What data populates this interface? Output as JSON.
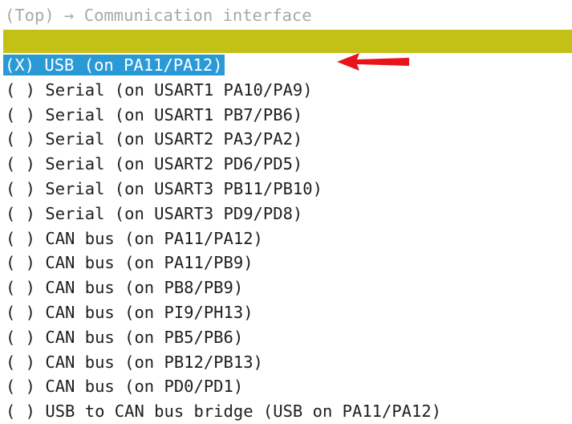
{
  "header": {
    "text": "(Top) → Communication interface"
  },
  "options": [
    {
      "label": "(X) USB (on PA11/PA12)",
      "selected": true
    },
    {
      "label": "( ) Serial (on USART1 PA10/PA9)",
      "selected": false
    },
    {
      "label": "( ) Serial (on USART1 PB7/PB6)",
      "selected": false
    },
    {
      "label": "( ) Serial (on USART2 PA3/PA2)",
      "selected": false
    },
    {
      "label": "( ) Serial (on USART2 PD6/PD5)",
      "selected": false
    },
    {
      "label": "( ) Serial (on USART3 PB11/PB10)",
      "selected": false
    },
    {
      "label": "( ) Serial (on USART3 PD9/PD8)",
      "selected": false
    },
    {
      "label": "( ) CAN bus (on PA11/PA12)",
      "selected": false
    },
    {
      "label": "( ) CAN bus (on PA11/PB9)",
      "selected": false
    },
    {
      "label": "( ) CAN bus (on PB8/PB9)",
      "selected": false
    },
    {
      "label": "( ) CAN bus (on PI9/PH13)",
      "selected": false
    },
    {
      "label": "( ) CAN bus (on PB5/PB6)",
      "selected": false
    },
    {
      "label": "( ) CAN bus (on PB12/PB13)",
      "selected": false
    },
    {
      "label": "( ) CAN bus (on PD0/PD1)",
      "selected": false
    },
    {
      "label": "( ) USB to CAN bus bridge (USB on PA11/PA12)",
      "selected": false
    }
  ],
  "colors": {
    "highlight": "#2a9ad6",
    "bar": "#c3c116",
    "arrow": "#e8141a"
  },
  "icons": {
    "annotation": "red-arrow-icon"
  }
}
